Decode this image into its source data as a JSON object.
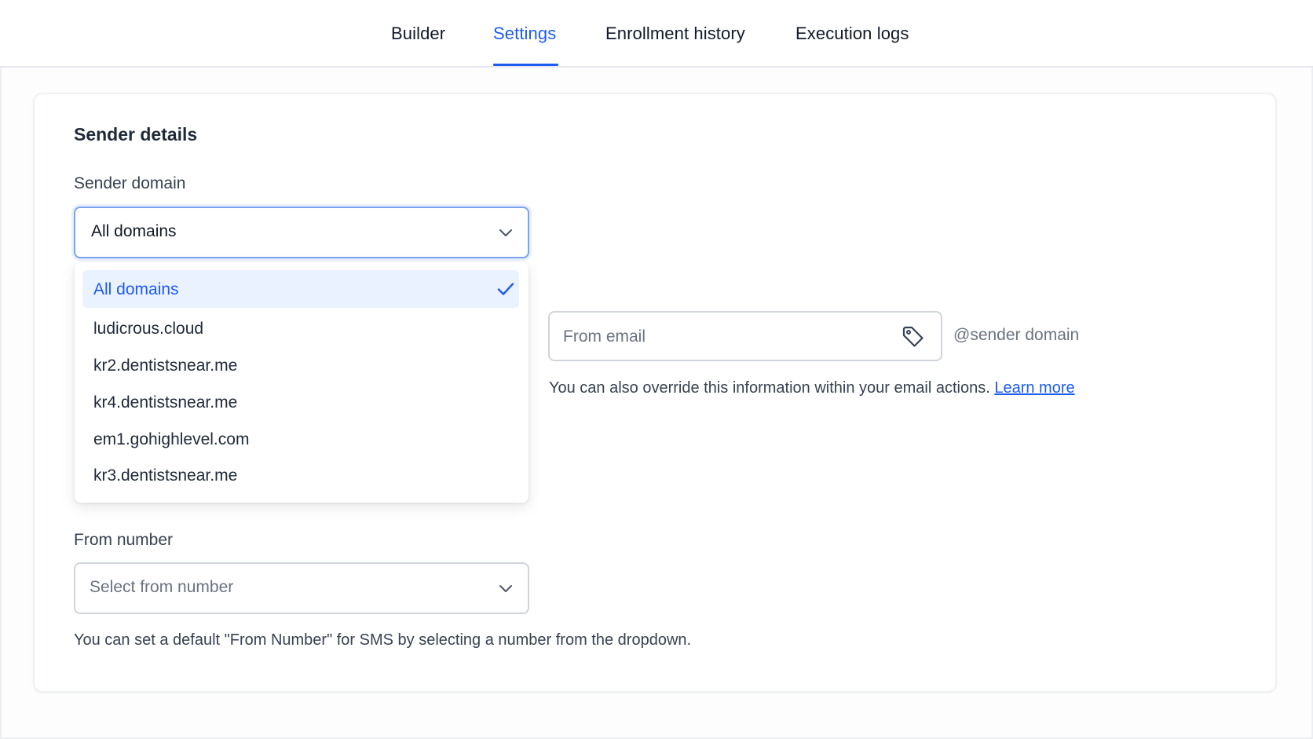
{
  "tabs": [
    {
      "label": "Builder",
      "active": false
    },
    {
      "label": "Settings",
      "active": true
    },
    {
      "label": "Enrollment history",
      "active": false
    },
    {
      "label": "Execution logs",
      "active": false
    }
  ],
  "sender_details": {
    "title": "Sender details",
    "sender_domain": {
      "label": "Sender domain",
      "selected_value": "All domains",
      "icon": "chevron-down-icon",
      "options": [
        {
          "label": "All domains",
          "selected": true
        },
        {
          "label": "ludicrous.cloud",
          "selected": false
        },
        {
          "label": "kr2.dentistsnear.me",
          "selected": false
        },
        {
          "label": "kr4.dentistsnear.me",
          "selected": false
        },
        {
          "label": "em1.gohighlevel.com",
          "selected": false
        },
        {
          "label": "kr3.dentistsnear.me",
          "selected": false
        }
      ]
    },
    "from_email": {
      "placeholder": "From email",
      "suffix": "@sender domain",
      "icon": "tag-icon",
      "help_text": "You can also override this information within your email actions.",
      "help_link": "Learn more"
    },
    "from_number": {
      "label": "From number",
      "placeholder": "Select from number",
      "icon": "chevron-down-icon",
      "help_text": "You can set a default \"From Number\" for SMS by selecting a number from the dropdown."
    }
  },
  "colors": {
    "accent": "#1d5cf0",
    "selected_option_bg": "#eaf1ff",
    "border": "#d1d5db",
    "focus_border": "#7ea2f2",
    "muted_text": "#6b7280"
  }
}
